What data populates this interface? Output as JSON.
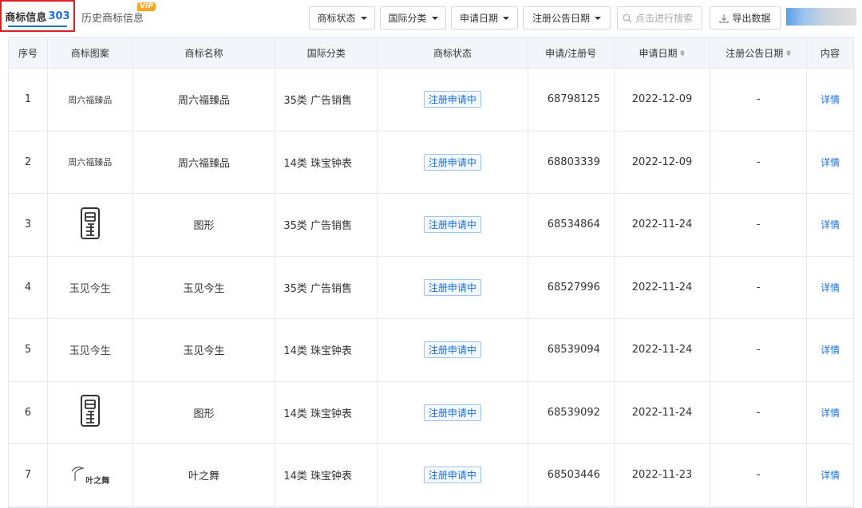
{
  "topbar": {
    "active_tab_label": "商标信息",
    "active_tab_count": "303",
    "history_tab_label": "历史商标信息",
    "vip_badge": "VIP",
    "filters": [
      "商标状态",
      "国际分类",
      "申请日期",
      "注册公告日期"
    ],
    "search_placeholder": "点击进行搜索",
    "export_label": "导出数据"
  },
  "table": {
    "headers": [
      "序号",
      "商标图案",
      "商标名称",
      "国际分类",
      "商标状态",
      "申请/注册号",
      "申请日期",
      "注册公告日期",
      "内容"
    ],
    "rows": [
      {
        "index": "1",
        "logo_text": "周六福臻品",
        "logo_type": "faded-text",
        "name": "周六福臻品",
        "class": "35类 广告销售",
        "status": "注册申请中",
        "reg_no": "68798125",
        "apply_date": "2022-12-09",
        "pub_date": "-",
        "action": "详情"
      },
      {
        "index": "2",
        "logo_text": "周六福臻品",
        "logo_type": "faded-text",
        "name": "周六福臻品",
        "class": "14类 珠宝钟表",
        "status": "注册申请中",
        "reg_no": "68803339",
        "apply_date": "2022-12-09",
        "pub_date": "-",
        "action": "详情"
      },
      {
        "index": "3",
        "logo_text": "",
        "logo_type": "seal",
        "name": "图形",
        "class": "35类 广告销售",
        "status": "注册申请中",
        "reg_no": "68534864",
        "apply_date": "2022-11-24",
        "pub_date": "-",
        "action": "详情"
      },
      {
        "index": "4",
        "logo_text": "玉见今生",
        "logo_type": "text",
        "name": "玉见今生",
        "class": "35类 广告销售",
        "status": "注册申请中",
        "reg_no": "68527996",
        "apply_date": "2022-11-24",
        "pub_date": "-",
        "action": "详情"
      },
      {
        "index": "5",
        "logo_text": "玉见今生",
        "logo_type": "text",
        "name": "玉见今生",
        "class": "14类 珠宝钟表",
        "status": "注册申请中",
        "reg_no": "68539094",
        "apply_date": "2022-11-24",
        "pub_date": "-",
        "action": "详情"
      },
      {
        "index": "6",
        "logo_text": "",
        "logo_type": "seal",
        "name": "图形",
        "class": "14类 珠宝钟表",
        "status": "注册申请中",
        "reg_no": "68539092",
        "apply_date": "2022-11-24",
        "pub_date": "-",
        "action": "详情"
      },
      {
        "index": "7",
        "logo_text": "叶之舞",
        "logo_type": "leaf",
        "name": "叶之舞",
        "class": "14类 珠宝钟表",
        "status": "注册申请中",
        "reg_no": "68503446",
        "apply_date": "2022-11-23",
        "pub_date": "-",
        "action": "详情"
      }
    ]
  },
  "colors": {
    "accent": "#1e6fd9",
    "highlight_border": "#e02020",
    "vip": "#f5a623",
    "header_bg": "#f2f6fb"
  }
}
